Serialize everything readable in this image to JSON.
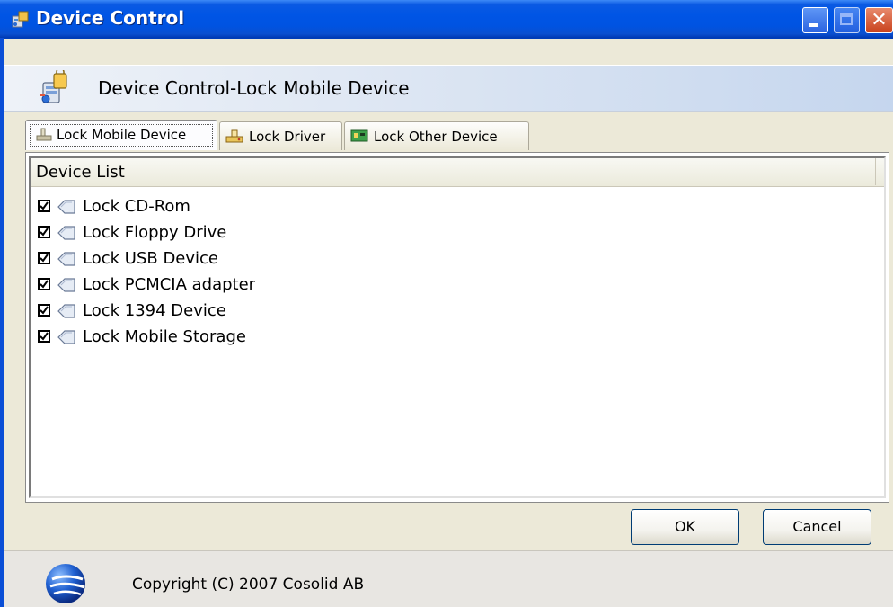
{
  "window": {
    "title": "Device Control",
    "controls": {
      "minimize": "minimize",
      "maximize": "maximize",
      "close": "✕"
    }
  },
  "header": {
    "title": "Device Control-Lock Mobile Device"
  },
  "tabs": [
    {
      "label": "Lock Mobile Device",
      "icon": "usb-drive-icon",
      "active": true
    },
    {
      "label": "Lock Driver",
      "icon": "drive-icon",
      "active": false
    },
    {
      "label": "Lock Other Device",
      "icon": "circuit-board-icon",
      "active": false
    }
  ],
  "device_list": {
    "column_header": "Device List",
    "items": [
      {
        "label": "Lock CD-Rom",
        "checked": true,
        "icon": "device-icon"
      },
      {
        "label": "Lock Floppy Drive",
        "checked": true,
        "icon": "device-icon"
      },
      {
        "label": "Lock USB Device",
        "checked": true,
        "icon": "device-icon"
      },
      {
        "label": "Lock PCMCIA adapter",
        "checked": true,
        "icon": "device-icon"
      },
      {
        "label": "Lock 1394 Device",
        "checked": true,
        "icon": "device-icon"
      },
      {
        "label": "Lock Mobile Storage",
        "checked": true,
        "icon": "device-icon"
      }
    ]
  },
  "buttons": {
    "ok": "OK",
    "cancel": "Cancel"
  },
  "footer": {
    "copyright": "Copyright (C) 2007 Cosolid AB"
  },
  "colors": {
    "titlebar": "#0055e5",
    "window_bg": "#ece9d8",
    "header_gradient_end": "#c5d6ee"
  }
}
